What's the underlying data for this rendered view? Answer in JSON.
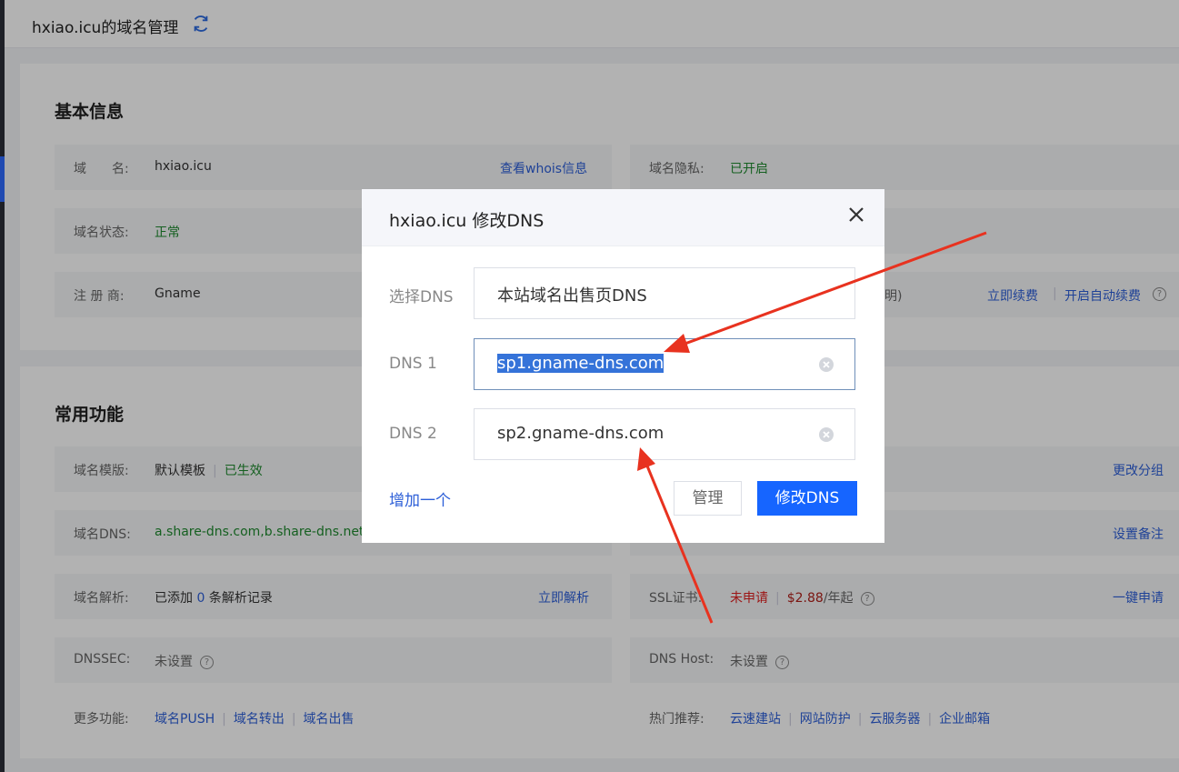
{
  "header": {
    "title": "hxiao.icu的域名管理",
    "refresh_icon": "refresh-icon"
  },
  "basic": {
    "heading": "基本信息",
    "domain_label": "域　　名:",
    "domain_value": "hxiao.icu",
    "whois_link": "查看whois信息",
    "privacy_label": "域名隐私:",
    "privacy_value": "已开启",
    "status_label": "域名状态:",
    "status_value": "正常",
    "registrar_label": "注 册 商:",
    "registrar_value": "Gname",
    "expiry_partial": "明)",
    "renew_link": "立即续费",
    "autorenew_link": "开启自动续费"
  },
  "features": {
    "heading": "常用功能",
    "template_label": "域名模版:",
    "template_value": "默认模板",
    "template_status": "已生效",
    "group_link": "更改分组",
    "dns_label": "域名DNS:",
    "dns_value": "a.share-dns.com,b.share-dns.net",
    "remark_link": "设置备注",
    "resolve_label": "域名解析:",
    "resolve_prefix": "已添加 ",
    "resolve_count": "0",
    "resolve_suffix": " 条解析记录",
    "resolve_link": "立即解析",
    "ssl_label": "SSL证书:",
    "ssl_status": "未申请",
    "ssl_price": "$2.88",
    "ssl_price_unit": "/年起",
    "ssl_link": "一键申请",
    "dnssec_label": "DNSSEC:",
    "dnssec_value": "未设置",
    "dnshost_label": "DNS Host:",
    "dnshost_value": "未设置",
    "more_label": "更多功能:",
    "more_items": [
      "域名PUSH",
      "域名转出",
      "域名出售"
    ],
    "hot_label": "热门推荐:",
    "hot_items": [
      "云速建站",
      "网站防护",
      "云服务器",
      "企业邮箱"
    ]
  },
  "dialog": {
    "title": "hxiao.icu 修改DNS",
    "select_label": "选择DNS",
    "select_value": "本站域名出售页DNS",
    "dns1_label": "DNS 1",
    "dns1_value": "sp1.gname-dns.com",
    "dns2_label": "DNS 2",
    "dns2_value": "sp2.gname-dns.com",
    "add_link": "增加一个",
    "manage_button": "管理",
    "submit_button": "修改DNS"
  },
  "colors": {
    "accent": "#1665ff",
    "link": "#2d5fd8",
    "success": "#1f8a2f",
    "danger": "#e02020",
    "annotation_arrow": "#e8321f"
  }
}
